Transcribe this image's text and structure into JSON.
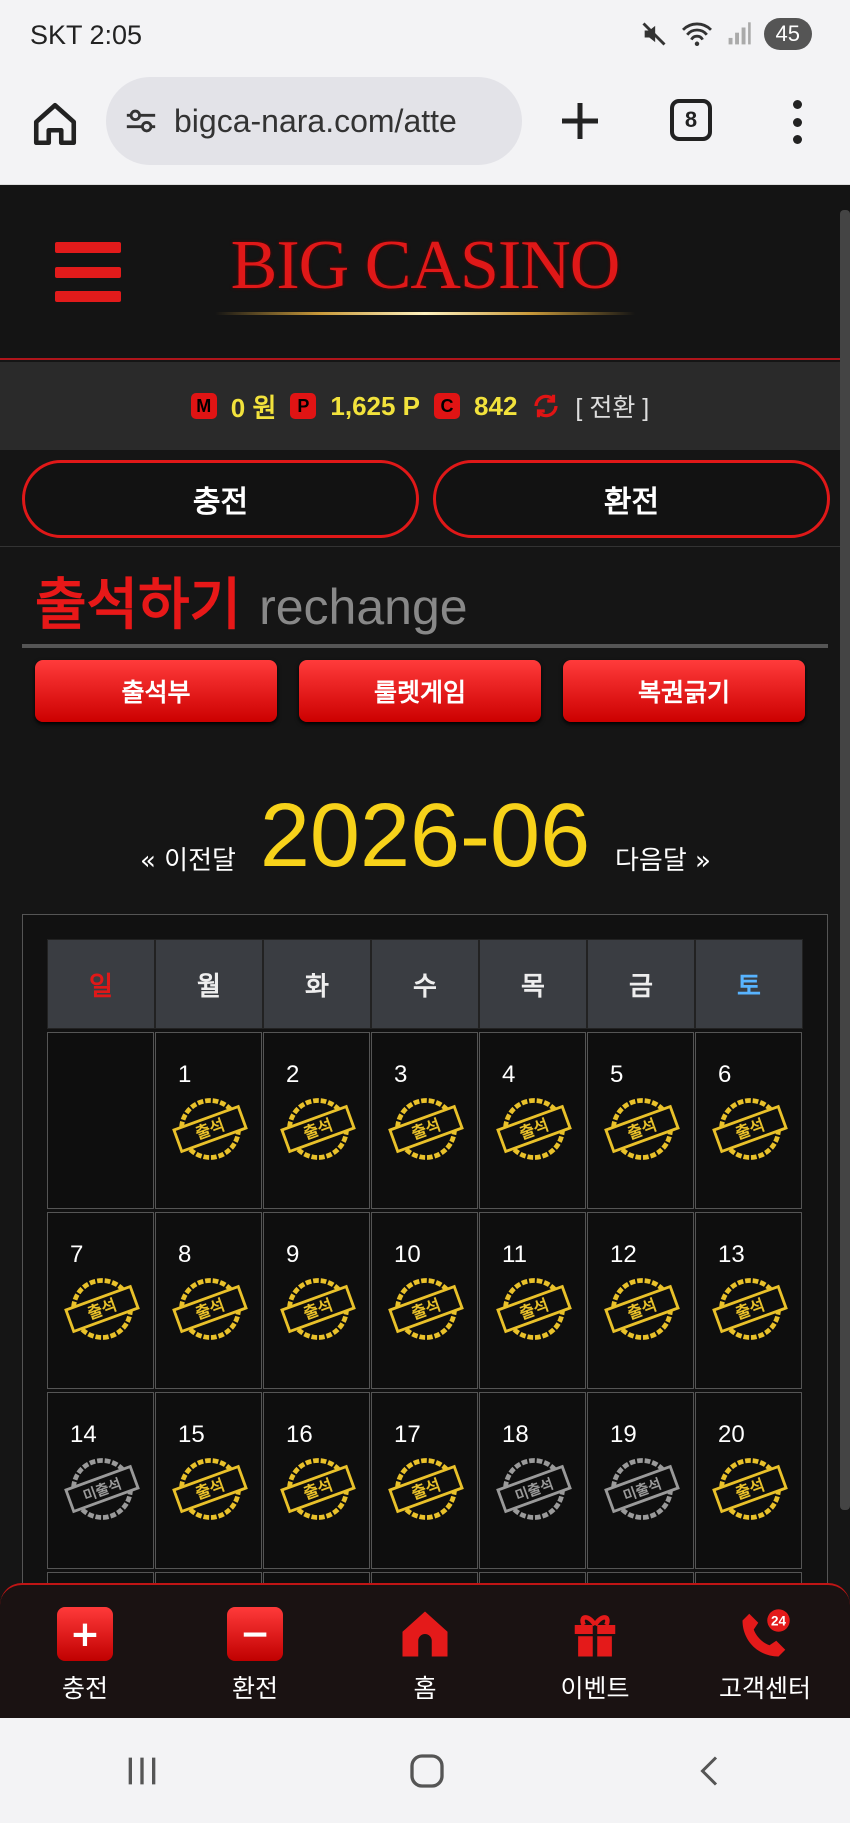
{
  "status_bar": {
    "carrier_time": "SKT 2:05",
    "battery": "45"
  },
  "browser": {
    "url": "bigca-nara.com/atte",
    "tab_count": "8"
  },
  "site": {
    "logo": "BIG CASINO"
  },
  "points": {
    "m_badge": "M",
    "m_value": "0 원",
    "p_badge": "P",
    "p_value": "1,625 P",
    "c_badge": "C",
    "c_value": "842",
    "convert_label": "[ 전환 ]"
  },
  "actions": {
    "charge": "충전",
    "exchange": "환전"
  },
  "section": {
    "title_kr": "출석하기",
    "title_en": "rechange"
  },
  "sub_buttons": [
    "출석부",
    "룰렛게임",
    "복권긁기"
  ],
  "month_nav": {
    "prev": "« 이전달",
    "current": "2026-06",
    "next": "다음달 »"
  },
  "calendar": {
    "weekdays": [
      "일",
      "월",
      "화",
      "수",
      "목",
      "금",
      "토"
    ],
    "stamp_attended": "출석",
    "stamp_missed": "미출석",
    "rows": [
      [
        {
          "day": "",
          "status": ""
        },
        {
          "day": "1",
          "status": "attended"
        },
        {
          "day": "2",
          "status": "attended"
        },
        {
          "day": "3",
          "status": "attended"
        },
        {
          "day": "4",
          "status": "attended"
        },
        {
          "day": "5",
          "status": "attended"
        },
        {
          "day": "6",
          "status": "attended"
        }
      ],
      [
        {
          "day": "7",
          "status": "attended"
        },
        {
          "day": "8",
          "status": "attended"
        },
        {
          "day": "9",
          "status": "attended"
        },
        {
          "day": "10",
          "status": "attended"
        },
        {
          "day": "11",
          "status": "attended"
        },
        {
          "day": "12",
          "status": "attended"
        },
        {
          "day": "13",
          "status": "attended"
        }
      ],
      [
        {
          "day": "14",
          "status": "missed"
        },
        {
          "day": "15",
          "status": "attended"
        },
        {
          "day": "16",
          "status": "attended"
        },
        {
          "day": "17",
          "status": "attended"
        },
        {
          "day": "18",
          "status": "missed"
        },
        {
          "day": "19",
          "status": "missed"
        },
        {
          "day": "20",
          "status": "attended"
        }
      ],
      [
        {
          "day": "",
          "status": ""
        },
        {
          "day": "",
          "status": ""
        },
        {
          "day": "",
          "status": ""
        },
        {
          "day": "",
          "status": ""
        },
        {
          "day": "",
          "status": ""
        },
        {
          "day": "",
          "status": ""
        },
        {
          "day": "",
          "status": ""
        }
      ]
    ]
  },
  "bottom_nav": [
    {
      "label": "충전",
      "icon": "plus-icon"
    },
    {
      "label": "환전",
      "icon": "minus-icon"
    },
    {
      "label": "홈",
      "icon": "home-icon"
    },
    {
      "label": "이벤트",
      "icon": "gift-icon"
    },
    {
      "label": "고객센터",
      "icon": "phone-24-icon",
      "badge": "24"
    }
  ],
  "colors": {
    "accent_red": "#e01818",
    "gold": "#f7d21a",
    "points_yellow": "#f2e23c"
  }
}
